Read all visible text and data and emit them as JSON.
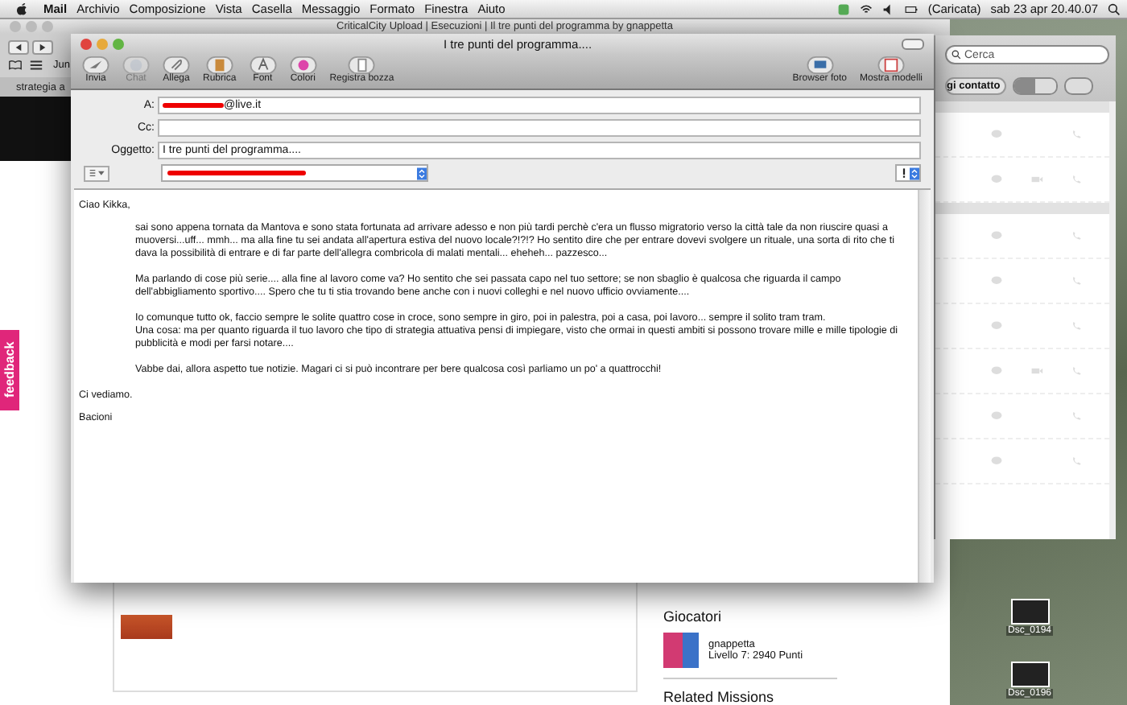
{
  "menubar": {
    "app": "Mail",
    "menus": [
      "Archivio",
      "Composizione",
      "Vista",
      "Casella",
      "Messaggio",
      "Formato",
      "Finestra",
      "Aiuto"
    ],
    "battery_status": "(Caricata)",
    "clock": "sab 23 apr  20.40.07"
  },
  "browser": {
    "title": "CriticalCity Upload | Esecuzioni | Il tre punti del programma by gnappetta",
    "bookmark": "Jun",
    "tab": "strategia a",
    "sidebar": {
      "heading": "Giocatori",
      "player_name": "gnappetta",
      "player_level": "Livello 7: 2940 Punti",
      "missions_heading": "Related Missions"
    }
  },
  "feedback_tab": "feedback",
  "contacts": {
    "search_placeholder": "Cerca",
    "add_button": "gi contatto",
    "views": [
      {
        "selected": true
      },
      {
        "selected": false
      }
    ],
    "sections": [
      {
        "rows": [
          {
            "video": false
          },
          {
            "video": true
          }
        ]
      },
      {
        "rows": [
          {
            "video": false
          },
          {
            "video": false
          },
          {
            "video": false
          },
          {
            "video": true
          },
          {
            "video": false
          },
          {
            "video": false
          }
        ]
      }
    ]
  },
  "desktop_icons": [
    {
      "label": "Dsc_0194"
    },
    {
      "label": "Dsc_0196"
    }
  ],
  "mail": {
    "title": "I tre punti del programma....",
    "toolbar": [
      {
        "kind": "send",
        "label": "Invia",
        "disabled": false
      },
      {
        "kind": "chat",
        "label": "Chat",
        "disabled": true
      },
      {
        "kind": "attach",
        "label": "Allega",
        "disabled": false
      },
      {
        "kind": "contacts",
        "label": "Rubrica",
        "disabled": false
      },
      {
        "kind": "font",
        "label": "Font",
        "disabled": false
      },
      {
        "kind": "colors",
        "label": "Colori",
        "disabled": false
      },
      {
        "kind": "draft",
        "label": "Registra bozza",
        "disabled": false
      }
    ],
    "toolbar_right": [
      {
        "kind": "photo",
        "label": "Browser foto",
        "disabled": false
      },
      {
        "kind": "templates",
        "label": "Mostra modelli",
        "disabled": false
      }
    ],
    "to_label": "A:",
    "to": "@live.it",
    "cc_label": "Cc:",
    "subject_label": "Oggetto:",
    "subject": "I tre punti del programma....",
    "greeting": "Ciao Kikka,",
    "paragraphs": [
      {
        "lines": [
          "sai sono appena tornata da Mantova e sono stata fortunata ad arrivare adesso e non più tardi perchè c'era un flusso migratorio verso la città tale da non riuscire quasi a muoversi...uff... mmh... ma alla fine tu sei andata all'apertura estiva del nuovo locale?!?!? Ho sentito dire che per entrare dovevi svolgere un rituale, una sorta di rito che ti dava la possibilità di entrare e di far parte dell'allegra combricola di malati mentali... eheheh... pazzesco..."
        ]
      },
      {
        "lines": [
          "Ma parlando di cose più serie.... alla fine al lavoro come va? Ho sentito che sei passata capo nel tuo settore; se non sbaglio è qualcosa che riguarda il campo dell'abbigliamento sportivo.... Spero che tu ti stia trovando bene anche con i nuovi colleghi e nel nuovo ufficio ovviamente...."
        ]
      },
      {
        "lines": [
          "Io comunque tutto ok, faccio sempre le solite quattro cose in croce, sono sempre in giro, poi in palestra, poi a casa, poi lavoro... sempre il solito tram tram.",
          "Una cosa: ma per quanto riguarda il tuo lavoro che tipo di strategia attuativa pensi di impiegare, visto che ormai in questi ambiti si possono trovare mille e mille tipologie di pubblicità e modi per farsi notare...."
        ]
      },
      {
        "lines": [
          "Vabbe dai, allora aspetto tue notizie. Magari ci si può incontrare per bere qualcosa così parliamo un po' a quattrocchi!"
        ]
      }
    ],
    "closing": [
      "Ci vediamo.",
      "Bacioni"
    ]
  }
}
